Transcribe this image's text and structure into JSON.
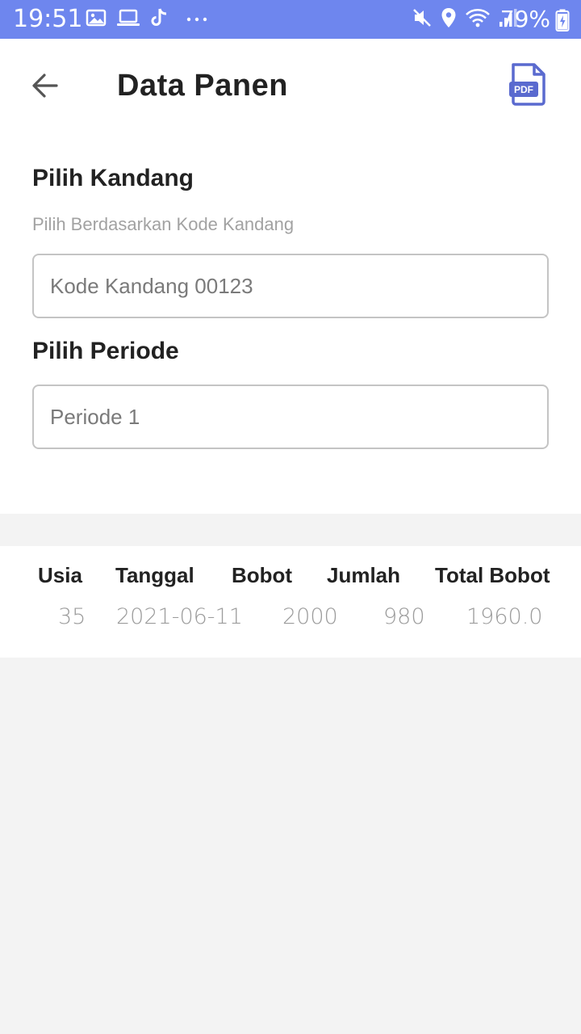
{
  "status_bar": {
    "time": "19:51",
    "battery": "79%",
    "left_icons": [
      "image-icon",
      "laptop-icon",
      "tiktok-icon",
      "more-dots-icon"
    ],
    "right_icons": [
      "mute-icon",
      "location-icon",
      "wifi-icon",
      "signal-icon",
      "battery-charging-icon"
    ],
    "background": "#6e86ee"
  },
  "header": {
    "title": "Data Panen",
    "back_icon": "arrow-left-icon",
    "pdf_icon": "pdf-file-icon",
    "pdf_label": "PDF",
    "accent": "#5a6acf"
  },
  "form": {
    "kandang": {
      "title": "Pilih Kandang",
      "helper": "Pilih Berdasarkan Kode Kandang",
      "value": "Kode Kandang 00123"
    },
    "periode": {
      "title": "Pilih Periode",
      "value": "Periode 1"
    }
  },
  "table": {
    "headers": [
      "Usia",
      "Tanggal",
      "Bobot",
      "Jumlah",
      "Total Bobot"
    ],
    "rows": [
      [
        "35",
        "2021-06-11",
        "2000",
        "980",
        "1960.0"
      ]
    ]
  }
}
